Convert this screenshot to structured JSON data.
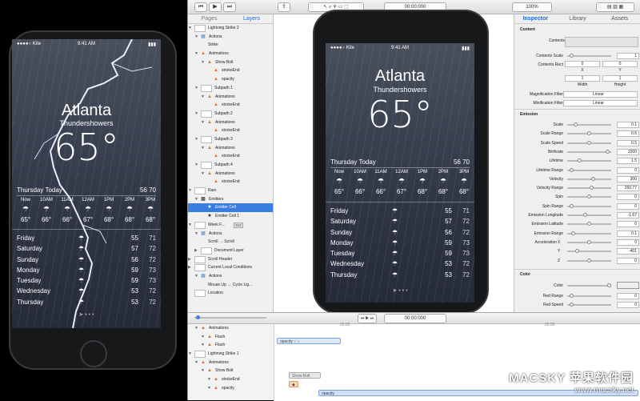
{
  "weather": {
    "carrier": "●●●●○ Kite",
    "wifi": "",
    "time": "9:41 AM",
    "battery": "",
    "city": "Atlanta",
    "condition": "Thundershowers",
    "temp": "65°",
    "today_label": "Thursday",
    "today_word": "Today",
    "high": "56",
    "low": "70",
    "hours": [
      {
        "label": "Now",
        "temp": "65°"
      },
      {
        "label": "10AM",
        "temp": "66°"
      },
      {
        "label": "11AM",
        "temp": "66°"
      },
      {
        "label": "12AM",
        "temp": "67°"
      },
      {
        "label": "1PM",
        "temp": "68°"
      },
      {
        "label": "2PM",
        "temp": "68°"
      },
      {
        "label": "3PM",
        "temp": "68°"
      }
    ],
    "days": [
      {
        "day": "Friday",
        "hi": "55",
        "lo": "71"
      },
      {
        "day": "Saturday",
        "hi": "57",
        "lo": "72"
      },
      {
        "day": "Sunday",
        "hi": "56",
        "lo": "72"
      },
      {
        "day": "Monday",
        "hi": "59",
        "lo": "73"
      },
      {
        "day": "Tuesday",
        "hi": "59",
        "lo": "73"
      },
      {
        "day": "Wednesday",
        "hi": "53",
        "lo": "72"
      },
      {
        "day": "Thursday",
        "hi": "53",
        "lo": "72"
      }
    ]
  },
  "toolbar": {
    "time": "00:00:000",
    "zoom": "100%"
  },
  "layers": {
    "tabs": [
      "Pages",
      "Layers"
    ],
    "rows": [
      {
        "label": "Lightning Strike 2",
        "indent": 0,
        "kind": "thumb",
        "arrow": "▼"
      },
      {
        "label": "Actions",
        "indent": 1,
        "kind": "act",
        "arrow": "▼"
      },
      {
        "label": "Strike",
        "indent": 2,
        "kind": "blank",
        "arrow": ""
      },
      {
        "label": "Animations",
        "indent": 1,
        "kind": "tri",
        "arrow": "▼"
      },
      {
        "label": "Show Bolt",
        "indent": 2,
        "kind": "tri",
        "arrow": "▼"
      },
      {
        "label": "strokeEnd",
        "indent": 3,
        "kind": "tri",
        "arrow": ""
      },
      {
        "label": "opacity",
        "indent": 3,
        "kind": "tri",
        "arrow": ""
      },
      {
        "label": "Subpath 1",
        "indent": 1,
        "kind": "thumb",
        "arrow": "▼"
      },
      {
        "label": "Animations",
        "indent": 2,
        "kind": "tri",
        "arrow": "▼"
      },
      {
        "label": "strokeEnd",
        "indent": 3,
        "kind": "tri",
        "arrow": ""
      },
      {
        "label": "Subpath 2",
        "indent": 1,
        "kind": "thumb",
        "arrow": "▼"
      },
      {
        "label": "Animations",
        "indent": 2,
        "kind": "tri",
        "arrow": "▼"
      },
      {
        "label": "strokeEnd",
        "indent": 3,
        "kind": "tri",
        "arrow": ""
      },
      {
        "label": "Subpath 3",
        "indent": 1,
        "kind": "thumb",
        "arrow": "▼"
      },
      {
        "label": "Animations",
        "indent": 2,
        "kind": "tri",
        "arrow": "▼"
      },
      {
        "label": "strokeEnd",
        "indent": 3,
        "kind": "tri",
        "arrow": ""
      },
      {
        "label": "Subpath 4",
        "indent": 1,
        "kind": "thumb",
        "arrow": "▼"
      },
      {
        "label": "Animations",
        "indent": 2,
        "kind": "tri",
        "arrow": "▼"
      },
      {
        "label": "strokeEnd",
        "indent": 3,
        "kind": "tri",
        "arrow": ""
      },
      {
        "label": "Rain",
        "indent": 0,
        "kind": "thumb",
        "arrow": "▼"
      },
      {
        "label": "Emitters",
        "indent": 1,
        "kind": "emit",
        "arrow": "▼"
      },
      {
        "label": "Emitter Cell",
        "indent": 2,
        "kind": "cell",
        "arrow": "",
        "sel": true
      },
      {
        "label": "Emitter Cell 1",
        "indent": 2,
        "kind": "cell",
        "arrow": ""
      },
      {
        "label": "Week F...",
        "indent": 0,
        "kind": "thumb",
        "arrow": "▼",
        "badge": "TXT"
      },
      {
        "label": "Actions",
        "indent": 1,
        "kind": "act",
        "arrow": "▼"
      },
      {
        "label": "Scroll → Scroll",
        "indent": 2,
        "kind": "blank",
        "arrow": ""
      },
      {
        "label": "Document Layer",
        "indent": 1,
        "kind": "thumb",
        "arrow": "▶"
      },
      {
        "label": "Scroll Header",
        "indent": 0,
        "kind": "thumb",
        "arrow": "▶"
      },
      {
        "label": "Current Local Conditions",
        "indent": 0,
        "kind": "thumb",
        "arrow": "▶"
      },
      {
        "label": "Actions",
        "indent": 1,
        "kind": "act",
        "arrow": "▼"
      },
      {
        "label": "Mouse Up → Cycle Lig...",
        "indent": 2,
        "kind": "blank",
        "arrow": ""
      },
      {
        "label": "Location",
        "indent": 0,
        "kind": "thumb",
        "arrow": ""
      }
    ]
  },
  "inspector": {
    "tabs": [
      "Inspector",
      "Library",
      "Assets"
    ],
    "content_title": "Content",
    "content_label": "Contents",
    "contents_scale_label": "Contents Scale",
    "contents_scale": "1",
    "contents_rect_label": "Contents Rect",
    "rect_x": "0",
    "rect_y": "0",
    "rect_w": "1",
    "rect_h": "1",
    "rect_x_label": "X",
    "rect_y_label": "Y",
    "rect_w_label": "Width",
    "rect_h_label": "Height",
    "mag_label": "Magnification Filter",
    "mag_value": "Linear",
    "min_label": "Minification Filter",
    "min_value": "Linear",
    "emission_title": "Emission",
    "props": [
      {
        "label": "Scale",
        "value": "0.1",
        "pos": 0.15
      },
      {
        "label": "Scale Range",
        "value": "0.6",
        "pos": 0.5
      },
      {
        "label": "Scale Speed",
        "value": "0.5",
        "pos": 0.5
      },
      {
        "label": "Birthrate",
        "value": "1500",
        "pos": 0.95
      },
      {
        "label": "Lifetime",
        "value": "1.5",
        "pos": 0.25
      },
      {
        "label": "Lifetime Range",
        "value": "0",
        "pos": 0.05
      },
      {
        "label": "Velocity",
        "value": "300",
        "pos": 0.6
      },
      {
        "label": "Velocity Range",
        "value": "250.77",
        "pos": 0.55
      },
      {
        "label": "Spin",
        "value": "0",
        "pos": 0.5
      },
      {
        "label": "Spin Range",
        "value": "0",
        "pos": 0.05
      },
      {
        "label": "Emission Longitude",
        "value": "-1.67",
        "pos": 0.4
      },
      {
        "label": "Emission Latitude",
        "value": "0",
        "pos": 0.5
      },
      {
        "label": "Emission Range",
        "value": "0.1",
        "pos": 0.1
      }
    ],
    "accel_label": "Acceleration",
    "accel": [
      {
        "axis": "X",
        "value": "0"
      },
      {
        "axis": "Y",
        "value": "-401"
      },
      {
        "axis": "Z",
        "value": "0"
      }
    ],
    "color_title": "Color",
    "color_label": "Color",
    "red_range_label": "Red Range",
    "red_range": "0",
    "red_speed_label": "Red Speed",
    "red_speed": "0"
  },
  "timeline": {
    "time": "00:00:000",
    "tick1": "00:05",
    "tick2": "00:06",
    "rows": [
      {
        "label": "Animations",
        "indent": 1,
        "kind": "tri"
      },
      {
        "label": "Flash",
        "indent": 2,
        "kind": "tri"
      },
      {
        "label": "Flash",
        "indent": 2,
        "kind": "tri"
      },
      {
        "label": "Lightning Strike 1",
        "indent": 0,
        "kind": "thumb"
      },
      {
        "label": "Animations",
        "indent": 1,
        "kind": "tri"
      },
      {
        "label": "Show Bolt",
        "indent": 2,
        "kind": "tri"
      },
      {
        "label": "strokeEnd",
        "indent": 3,
        "kind": "tri"
      },
      {
        "label": "opacity",
        "indent": 3,
        "kind": "tri"
      }
    ],
    "bars": [
      "opacity",
      "Show Bolt",
      "strokeEnd",
      "opacity"
    ]
  },
  "watermark": {
    "brand": "MACSKY 苹果软件园",
    "url": "www.macsky.net"
  }
}
